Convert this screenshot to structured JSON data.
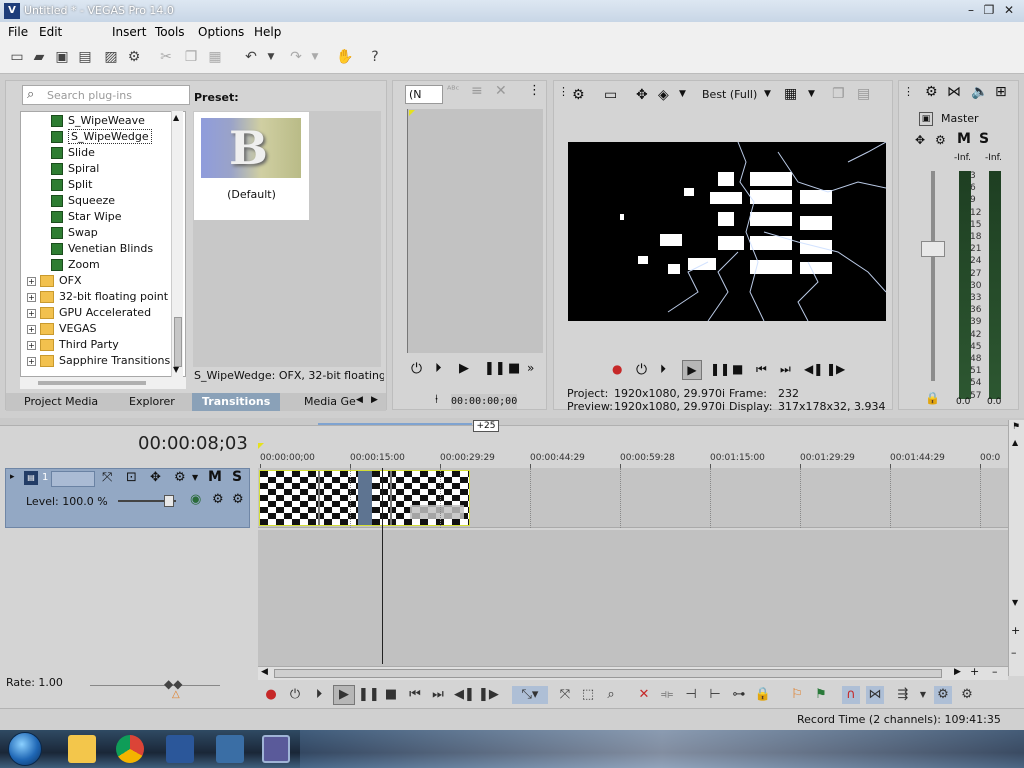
{
  "window": {
    "title": "Untitled * - VEGAS Pro 14.0",
    "controls": [
      "–",
      "❐",
      "✕"
    ]
  },
  "menu": [
    "File",
    "Edit",
    "Insert",
    "Tools",
    "Options",
    "Help"
  ],
  "explorer": {
    "search_placeholder": "Search plug-ins",
    "preset_label": "Preset:",
    "preset_name": "(Default)",
    "preset_description": "S_WipeWedge: OFX, 32-bit floating po",
    "tree_items": [
      {
        "label": "S_WipeWeave",
        "type": "fx",
        "indent": 2
      },
      {
        "label": "S_WipeWedge",
        "type": "fx",
        "indent": 2,
        "selected": true
      },
      {
        "label": "Slide",
        "type": "fx",
        "indent": 2
      },
      {
        "label": "Spiral",
        "type": "fx",
        "indent": 2
      },
      {
        "label": "Split",
        "type": "fx",
        "indent": 2
      },
      {
        "label": "Squeeze",
        "type": "fx",
        "indent": 2
      },
      {
        "label": "Star Wipe",
        "type": "fx",
        "indent": 2
      },
      {
        "label": "Swap",
        "type": "fx",
        "indent": 2
      },
      {
        "label": "Venetian Blinds",
        "type": "fx",
        "indent": 2
      },
      {
        "label": "Zoom",
        "type": "fx",
        "indent": 2
      },
      {
        "label": "OFX",
        "type": "folder",
        "indent": 0
      },
      {
        "label": "32-bit floating point",
        "type": "folder",
        "indent": 0
      },
      {
        "label": "GPU Accelerated",
        "type": "folder",
        "indent": 0
      },
      {
        "label": "VEGAS",
        "type": "folder",
        "indent": 0
      },
      {
        "label": "Third Party",
        "type": "folder",
        "indent": 0
      },
      {
        "label": "Sapphire Transitions",
        "type": "folder",
        "indent": 0
      }
    ],
    "tabs": [
      "Project Media",
      "Explorer",
      "Transitions",
      "Media Ge"
    ],
    "active_tab": 2
  },
  "trimmer": {
    "select_value": "(N",
    "time": "00:00:00;00"
  },
  "preview": {
    "quality": "Best (Full)",
    "project_label": "Project:",
    "project_value": "1920x1080, 29.970i",
    "preview_label": "Preview:",
    "preview_value": "1920x1080, 29.970i",
    "frame_label": "Frame:",
    "frame_value": "232",
    "display_label": "Display:",
    "display_value": "317x178x32, 3.934"
  },
  "master": {
    "label": "Master",
    "meter_top_labels": [
      "-Inf.",
      "-Inf."
    ],
    "meter_bottom_labels": [
      "0.0",
      "0.0"
    ],
    "scale": [
      "3",
      "6",
      "9",
      "12",
      "15",
      "18",
      "21",
      "24",
      "27",
      "30",
      "33",
      "36",
      "39",
      "42",
      "45",
      "48",
      "51",
      "54",
      "57"
    ]
  },
  "timeline": {
    "timecode": "00:00:08;03",
    "track_number": "1",
    "level_label": "Level: 100.0 %",
    "ruler_ticks": [
      "00:00:00;00",
      "00:00:15:00",
      "00:00:29:29",
      "00:00:44:29",
      "00:00:59:28",
      "00:01:15:00",
      "00:01:29:29",
      "00:01:44:29",
      "00:0"
    ],
    "drag_tooltip": "+25"
  },
  "rate": {
    "label": "Rate: 1.00"
  },
  "status": {
    "record_time": "Record Time (2 channels): 109:41:35"
  },
  "colors": {
    "track_header": "#93a8c4",
    "event_border": "#d4de34",
    "active_tab": "#8aa1b8"
  }
}
